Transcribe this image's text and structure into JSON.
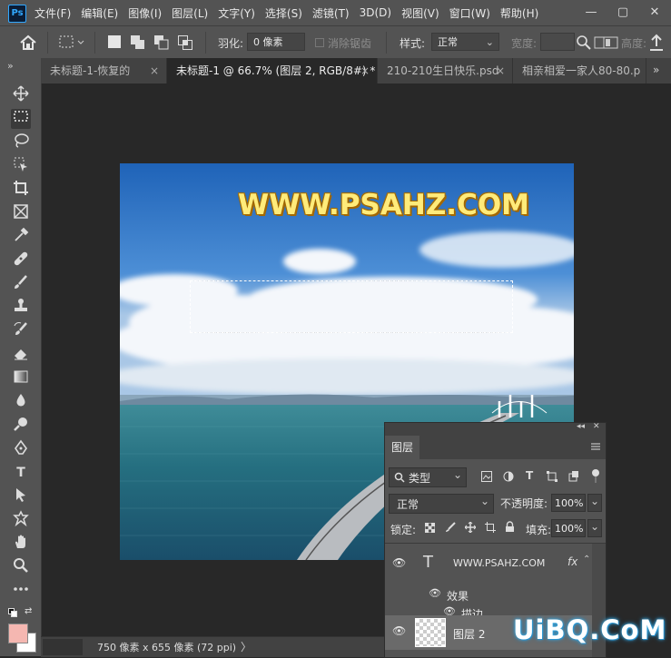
{
  "app": {
    "logo": "Ps"
  },
  "menu": [
    "文件(F)",
    "编辑(E)",
    "图像(I)",
    "图层(L)",
    "文字(Y)",
    "选择(S)",
    "滤镜(T)",
    "3D(D)",
    "视图(V)",
    "窗口(W)",
    "帮助(H)"
  ],
  "window_controls": {
    "minimize": "—",
    "maximize": "▢",
    "close": "✕"
  },
  "options": {
    "feather_label": "羽化:",
    "feather_value": "0 像素",
    "antialias_label": "消除锯齿",
    "style_label": "样式:",
    "style_value": "正常",
    "width_label": "宽度:",
    "height_label": "高度:"
  },
  "tabs": [
    {
      "label": "未标题-1-恢复的",
      "close": "×",
      "active": false
    },
    {
      "label": "未标题-1 @ 66.7% (图层 2, RGB/8#) *",
      "close": "×",
      "active": true
    },
    {
      "label": "210-210生日快乐.psd",
      "close": "×",
      "active": false
    },
    {
      "label": "相亲相爱一家人80-80.p",
      "close": "",
      "active": false
    }
  ],
  "tab_overflow": "»",
  "toolbar_collapse": "»",
  "canvas": {
    "watermark_text": "WWW.PSAHZ.COM"
  },
  "layers_panel": {
    "title": "图层",
    "panel_collapse": "◂◂",
    "panel_close": "✕",
    "filter_kind": "类型",
    "blend_mode": "正常",
    "opacity_label": "不透明度:",
    "opacity_value": "100%",
    "lock_label": "锁定:",
    "fill_label": "填充:",
    "fill_value": "100%",
    "layers": [
      {
        "name": "WWW.PSAHZ.COM",
        "type": "text",
        "fx": "fx"
      },
      {
        "name": "效果",
        "type": "effects-group"
      },
      {
        "name": "描边",
        "type": "effect"
      },
      {
        "name": "图层 2",
        "type": "pixel"
      }
    ]
  },
  "status": {
    "doc_size": "750 像素 x 655 像素 (72 ppi)",
    "arrow": "〉"
  },
  "watermark": "UiBQ.CoM",
  "colors": {
    "accent": "#31a8ff",
    "panel": "#535353",
    "workspace": "#282828",
    "watermark_yellow": "#ffeb7a"
  }
}
